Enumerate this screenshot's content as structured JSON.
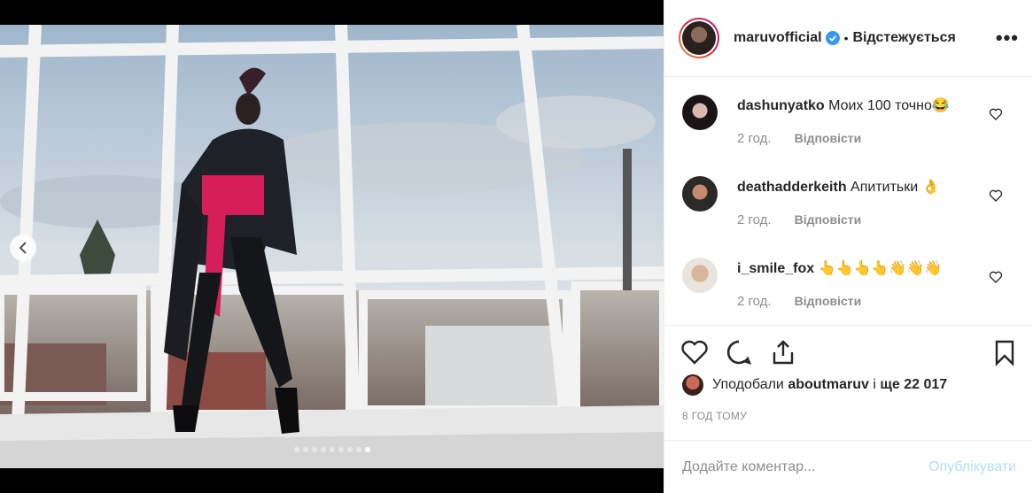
{
  "header": {
    "username": "maruvofficial",
    "separator": "•",
    "follow_status": "Відстежується",
    "more_icon": "ellipsis-icon"
  },
  "carousel": {
    "slide_count": 9,
    "active_index": 8
  },
  "comments": [
    {
      "user": "dashunyatko",
      "text": "Моих 100 точно😂",
      "time": "2 год.",
      "reply": "Відповісти"
    },
    {
      "user": "deathadderkeith",
      "text": "Апититьки 👌",
      "time": "2 год.",
      "reply": "Відповісти"
    },
    {
      "user": "i_smile_fox",
      "text": "👆👆👆👆👋👋👋",
      "time": "2 год.",
      "reply": "Відповісти"
    }
  ],
  "likes": {
    "prefix": "Уподобали",
    "user": "aboutmaruv",
    "middle": "і",
    "rest": "ще 22 017"
  },
  "timestamp": "8 ГОД ТОМУ",
  "composer": {
    "placeholder": "Додайте коментар...",
    "post_label": "Опублікувати"
  }
}
